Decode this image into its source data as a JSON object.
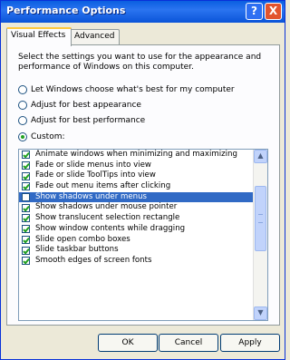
{
  "window": {
    "title": "Performance Options",
    "help_symbol": "?",
    "close_symbol": "X"
  },
  "tabs": [
    {
      "label": "Visual Effects",
      "active": true
    },
    {
      "label": "Advanced",
      "active": false
    }
  ],
  "description": "Select the settings you want to use for the appearance and performance of Windows on this computer.",
  "options": [
    {
      "label": "Let Windows choose what's best for my computer",
      "selected": false
    },
    {
      "label": "Adjust for best appearance",
      "selected": false
    },
    {
      "label": "Adjust for best performance",
      "selected": false
    },
    {
      "label": "Custom:",
      "selected": true
    }
  ],
  "effects": [
    {
      "label": "Animate windows when minimizing and maximizing",
      "checked": true,
      "selected": false
    },
    {
      "label": "Fade or slide menus into view",
      "checked": true,
      "selected": false
    },
    {
      "label": "Fade or slide ToolTips into view",
      "checked": true,
      "selected": false
    },
    {
      "label": "Fade out menu items after clicking",
      "checked": true,
      "selected": false
    },
    {
      "label": "Show shadows under menus",
      "checked": false,
      "selected": true
    },
    {
      "label": "Show shadows under mouse pointer",
      "checked": true,
      "selected": false
    },
    {
      "label": "Show translucent selection rectangle",
      "checked": true,
      "selected": false
    },
    {
      "label": "Show window contents while dragging",
      "checked": true,
      "selected": false
    },
    {
      "label": "Slide open combo boxes",
      "checked": true,
      "selected": false
    },
    {
      "label": "Slide taskbar buttons",
      "checked": true,
      "selected": false
    },
    {
      "label": "Smooth edges of screen fonts",
      "checked": true,
      "selected": false
    }
  ],
  "buttons": {
    "ok": "OK",
    "cancel": "Cancel",
    "apply": "Apply"
  },
  "colors": {
    "titlebar": "#0a5fe0",
    "selection": "#316ac5",
    "check": "#21a121",
    "close": "#e2542e"
  }
}
